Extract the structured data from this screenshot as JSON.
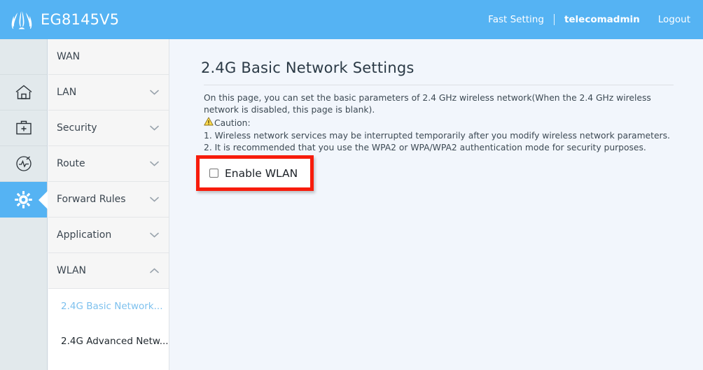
{
  "header": {
    "brand": "EG8145V5",
    "logo_icon": "huawei-flower-logo",
    "fast_setting": "Fast Setting",
    "user": "telecomadmin",
    "logout": "Logout"
  },
  "icon_rail": {
    "items": [
      {
        "name": "spacer",
        "icon": "none",
        "active": false
      },
      {
        "name": "home",
        "icon": "home-icon",
        "active": false
      },
      {
        "name": "toolbox",
        "icon": "toolbox-icon",
        "active": false
      },
      {
        "name": "diagnose",
        "icon": "diagnose-gauge-icon",
        "active": false
      },
      {
        "name": "settings",
        "icon": "gear-icon",
        "active": true
      }
    ]
  },
  "menu": {
    "items": [
      {
        "label": "WAN",
        "chevron": "none",
        "expanded": false
      },
      {
        "label": "LAN",
        "chevron": "chevron-down-icon",
        "expanded": false
      },
      {
        "label": "Security",
        "chevron": "chevron-down-icon",
        "expanded": false
      },
      {
        "label": "Route",
        "chevron": "chevron-down-icon",
        "expanded": false
      },
      {
        "label": "Forward Rules",
        "chevron": "chevron-down-icon",
        "expanded": false
      },
      {
        "label": "Application",
        "chevron": "chevron-down-icon",
        "expanded": false
      },
      {
        "label": "WLAN",
        "chevron": "chevron-up-icon",
        "expanded": true
      }
    ],
    "submenu": [
      {
        "label": "2.4G Basic Network...",
        "active": true
      },
      {
        "label": "2.4G Advanced Netw...",
        "active": false
      }
    ]
  },
  "content": {
    "title": "2.4G Basic Network Settings",
    "desc_line1": "On this page, you can set the basic parameters of 2.4 GHz wireless network(When the 2.4 GHz wireless network is disabled, this page is blank).",
    "caution_label": "Caution:",
    "caution_icon": "warning-triangle-icon",
    "note1": "1. Wireless network services may be interrupted temporarily after you modify wireless network parameters.",
    "note2": "2. It is recommended that you use the WPA2 or WPA/WPA2 authentication mode for security purposes.",
    "enable_wlan_label": "Enable WLAN",
    "enable_wlan_checked": false
  },
  "colors": {
    "header_blue": "#55b3f3",
    "active_blue": "#55b3f3",
    "highlight_red": "#f71c0c",
    "content_bg": "#f2f6fc",
    "rail_bg": "#e2e9ec",
    "submenu_link": "#7ec1ee"
  }
}
